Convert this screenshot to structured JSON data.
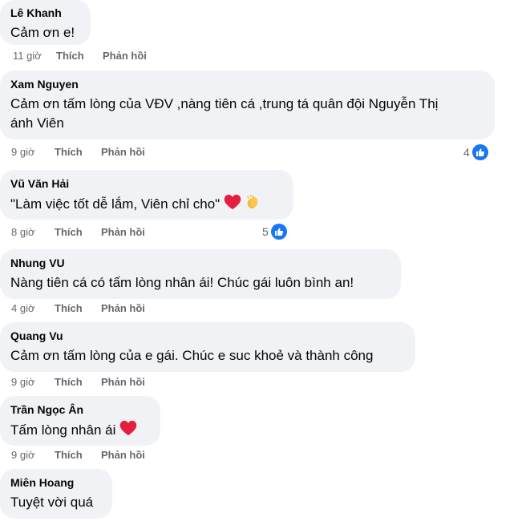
{
  "actions": {
    "like": "Thích",
    "reply": "Phản hồi"
  },
  "comments": [
    {
      "author": "Lê Khanh",
      "text": "Cảm ơn e!",
      "time": "11 giờ"
    },
    {
      "author": "Xam Nguyen",
      "text_line1": "Cảm ơn tấm lòng của VĐV ,nàng tiên cá ,trung tá quân đội Nguyễn Thị",
      "text_line2": "ánh Viên",
      "time": "9 giờ",
      "reactions": "4"
    },
    {
      "author": "Vũ Văn Hải",
      "text": "\"Làm việc tốt dễ lắm, Viên chỉ cho\"",
      "time": "8 giờ",
      "reactions": "5"
    },
    {
      "author": "Nhung VU",
      "text": "Nàng tiên cá có tấm lòng nhân ái! Chúc gái luôn bình an!",
      "time": "4 giờ"
    },
    {
      "author": "Quang Vu",
      "text": "Cảm ơn tấm lòng của e gái. Chúc e suc khoẻ và thành công",
      "time": "9 giờ"
    },
    {
      "author": "Trần Ngọc Ân",
      "text": "Tấm lòng nhân ái",
      "time": "9 giờ"
    },
    {
      "author": "Miên Hoang",
      "text": "Tuyệt vời quá"
    }
  ],
  "colors": {
    "bubble": "#f0f2f5",
    "meta": "#65676b",
    "like_blue": "#1877f2",
    "heart": "#e41e3f"
  },
  "icons": [
    "like-thumb-icon",
    "red-heart-emoji",
    "clapping-hands-emoji"
  ]
}
